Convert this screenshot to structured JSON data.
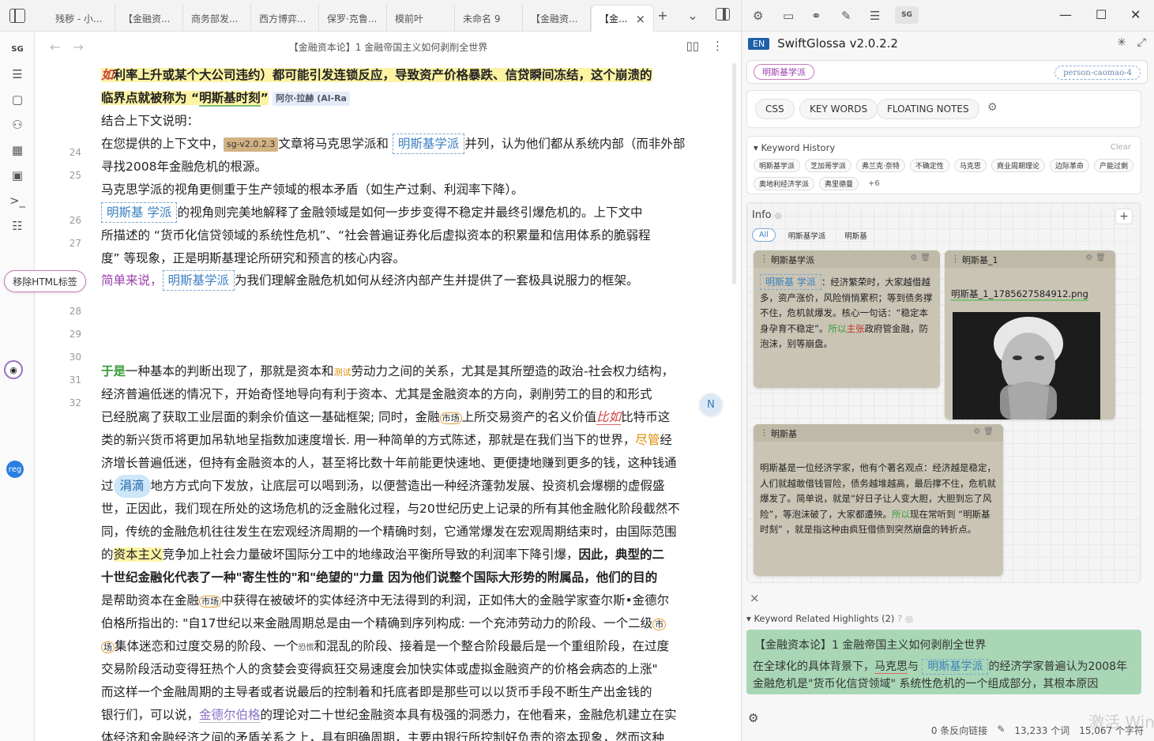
{
  "tabs": [
    {
      "label": "残秽 - 小..."
    },
    {
      "label": "【金融资..."
    },
    {
      "label": "商务部发..."
    },
    {
      "label": "西方博弈..."
    },
    {
      "label": "保罗·克鲁..."
    },
    {
      "label": "模前叶"
    },
    {
      "label": "未命名 9"
    },
    {
      "label": "【金融资..."
    },
    {
      "label": "【金..."
    }
  ],
  "tab_actions": {
    "new_tab": "+",
    "menu": "⌄"
  },
  "ribbon": {
    "sg": "SG"
  },
  "editor": {
    "title": "【金融资本论】1 金融帝国主义如何剥削全世界",
    "line_numbers": [
      "24",
      "25",
      "26",
      "27",
      "28",
      "29",
      "30",
      "31",
      "32"
    ],
    "l0_prefix": "如",
    "l0_text": "利率上升或某个大公司违约）都可能引发连锁反应，导致资产价格暴跌、信贷瞬间冻结，这个崩溃的",
    "l1_text": "临界点就被称为 “",
    "l1_kw": "明斯基时刻",
    "l1_end": "”",
    "l1_tag": "阿尔·拉赫 (Al-Ra",
    "l2_text": "结合上下文说明：",
    "l3_a": "在您提供的上下文中，",
    "l3_sg": "sg-v2.0.2.3",
    "l3_b": "文章将马克思学派和",
    "l3_kw": "明斯基学派",
    "l3_c": "并列，认为他们都从系统内部（而非外部冲击）",
    "l4_text": "寻找2008年金融危机的根源。",
    "l5_text": "马克思学派的视角更侧重于生产领域的根本矛盾（如生产过剩、利润率下降）。",
    "l6_kw": "明斯基    学派",
    "l6_text": "的视角则完美地解释了金融领域是如何一步步变得不稳定并最终引爆危机的。上下文中",
    "l7_text": "所描述的 “货币化信贷领域的系统性危机”、“社会普遍证券化后虚拟资本的积累量和信用体系的脆弱程",
    "l8_text": "度” 等现象，正是明斯基理论所研究和预言的核心内容。",
    "l9_a": "简单来说，",
    "l9_kw": "明斯基学派",
    "l9_b": "为我们理解金融危机如何从经济内部产生并提供了一套极具说服力的框架。",
    "p_lines": [
      "一种基本的判断出现了，那就是资本和",
      "经济普遍低迷的情况下，开始奇怪地导向有利于资本、尤其是金融资本的方向，剥削劳工的目的和形式",
      "已经脱离了获取工业层面的剩余价值这一基础框架; 同时，金融",
      "类的新兴货币将更加吊轨地呈指数加速度增长. 用一种简单的方式陈述，那就是在我们当下的世界，",
      "济增长普遍低迷，但持有金融资本的人，甚至将比数十年前能更快速地、更便捷地赚到更多的钱，这种钱通",
      "过",
      "世，正因此，我们现在所处的这场危机的泛金融化过程，与20世纪历史上记录的所有其他金融化阶段截然不",
      "同，传统的金融危机往往发生在宏观经济周期的一个精确时刻，它通常爆发在宏观周期结束时，由国际范围",
      "的",
      "十世纪金融化代表了一种\"寄生性的\"和\"绝望的\"力量  因为他们说整个国际大形势的附属品，他们的目的",
      "是帮助资本在金融",
      "伯格所指出的: \"自17世纪以来金融周期总是由一个精确到序列构成: 一个充沛劳动力的阶段、一个二级",
      "集体迷恋和过度交易的阶段、一个",
      "交易阶段活动变得狂热个人的贪婪会变得疯狂交易速度会加快实体或虚拟金融资产的价格会病态的上涨\"",
      " 而这样一个金融周期的主导者或者说最后的控制着和托底者即是那些可以以货币手段不断生产出金钱的",
      "银行们，可以说，",
      "体经济和金融经济之间的矛盾关系之上，具有明确周期，主要由银行所控制好负责的资本现象，然而这种"
    ],
    "p0_prefix": "于是",
    "p0_tag": "测试",
    "p0_end": "劳动力之间的关系，尤其是其所塑造的政治-社会权力结构，",
    "p2_circle": "市场",
    "p2_b": "上所交易资产的名义价值",
    "p2_red": "比如",
    "p2_c": "比特币这",
    "p3_orange": "尽管",
    "p3_end": "经",
    "p5_bubble": "涓滴",
    "p5_b": "地方方式向下发放，让底层可以喝到汤，以便营造出一种经济蓬勃发展、投资机会爆棚的虚假盛",
    "p8_hl": "资本主义",
    "p8_b": "竞争加上社会力量破坏国际分工中的地缘政治平衡所导致的利润率下降引爆，",
    "p8_bold": "因此，典型的二",
    "p10_circle": "市场",
    "p10_b": "中获得在被破坏的实体经济中无法得到的利润，正如伟大的金融学家查尔斯•金德尔",
    "p11_end": "市",
    "p12_start": "场",
    "p12_mid": "恐慌",
    "p12_b": "和混乱的阶段、接着是一个整合阶段最后是一个重组阶段，在过度",
    "p15_link": "金德尔伯格",
    "p15_b": "的理论对二十世纪金融资本具有极强的洞悉力，在他看来，金融危机建立在实"
  },
  "floating": {
    "remove_html": "移除HTML标签",
    "reg": "reg",
    "n": "N"
  },
  "right": {
    "en_badge": "EN",
    "app_title": "SwiftGlossa v2.0.2.2",
    "search_chip": "明斯基学派",
    "search_tag": "person-caomao-4",
    "buttons": [
      "CSS",
      "KEY WORDS",
      "FLOATING NOTES"
    ],
    "kh_title": "Keyword History",
    "kh_clear": "Clear",
    "kh_chips": [
      "明斯基学派",
      "芝加哥学派",
      "弗兰克·奈特",
      "不确定性",
      "马克思",
      "商业周期理论",
      "边际革命",
      "产能过剩",
      "奥地利经济学派",
      "弗里德曼",
      "+6"
    ],
    "info_title": "Info",
    "info_filters": [
      "All",
      "明斯基学派",
      "明斯基"
    ],
    "card1": {
      "title": "明斯基学派",
      "kw": "明斯基    学派",
      "a": "：经济繁荣时，大家越借越多，资产涨价，风险悄悄累积；等到债务撑不住，危机就爆发。核心一句话：“稳定本身孕育不稳定”。",
      "b": "所以",
      "c": "主张",
      "d": "政府管金融，防泡沫，别等崩盘。"
    },
    "card2": {
      "title": "明斯基_1",
      "file": "明斯基_1_1785627584912.png"
    },
    "card3": {
      "title": "明斯基",
      "a": "明斯基是一位经济学家，他有个著名观点：经济越是稳定，人们就越敢借钱冒险，债务越堆越高，最后撑不住，危机就爆发了。简单说，就是“好日子让人变大胆，大胆到忘了风险”，等泡沫破了，大家都遭殃。",
      "b": "所以",
      "c": "现在常听到 “明斯基时刻” ，就是指这种由疯狂借债到突然崩盘的转折点。"
    },
    "rkh_close": "×",
    "rkh_title": "Keyword Related Highlights (2)",
    "rkh_head": "【金融资本论】1 金融帝国主义如何剥削全世界",
    "rkh_a": "在全球化的具体背景下，",
    "rkh_b": "马克思",
    "rkh_c": "与",
    "rkh_kw": "明斯基学派",
    "rkh_d": "的经济学家普遍认为2008年金融危机是\"货币化信贷领域\" 系统性危机的一个组成部分，其根本原因",
    "status": [
      "0 条反向链接",
      "13,233 个词",
      "15,067 个字符"
    ],
    "watermark": "激活 Win"
  }
}
